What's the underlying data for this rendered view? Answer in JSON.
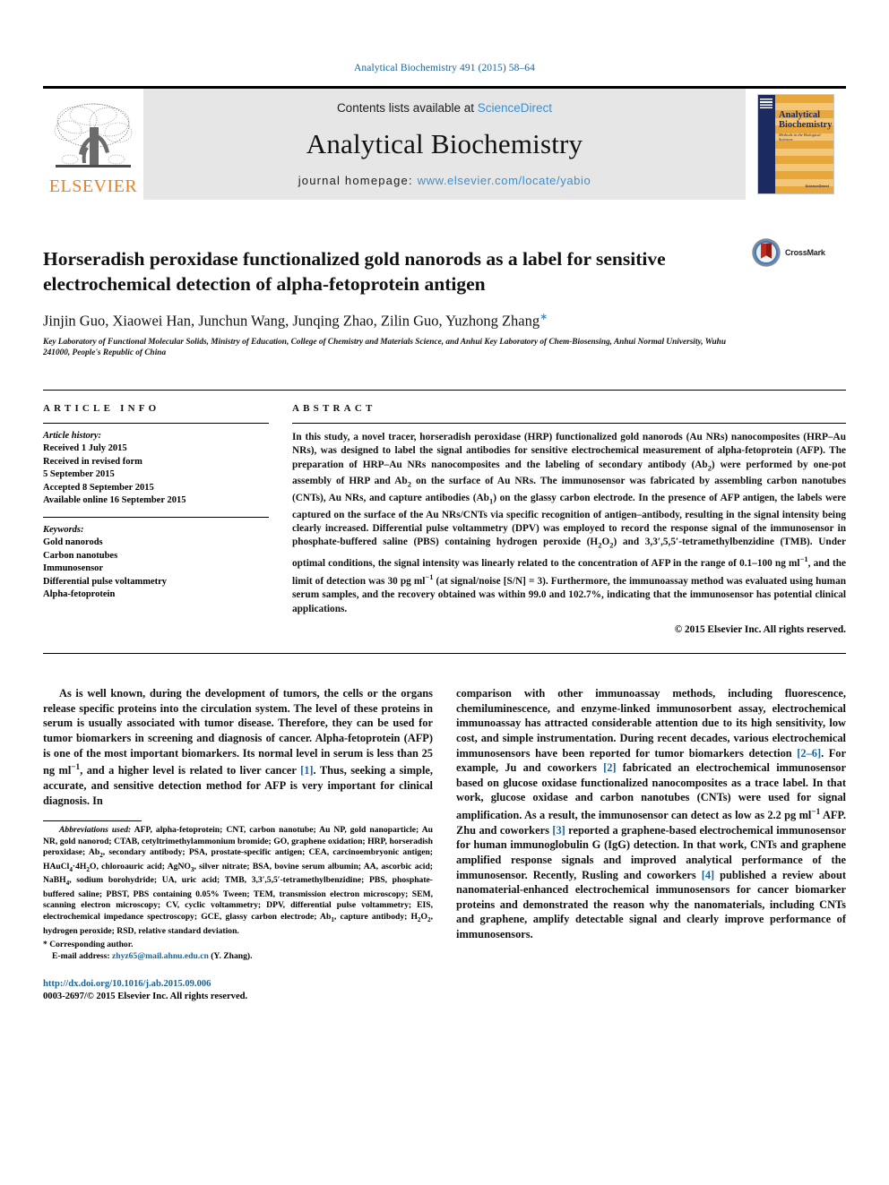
{
  "running_head": "Analytical Biochemistry 491 (2015) 58–64",
  "masthead": {
    "publisher": "ELSEVIER",
    "contents_prefix": "Contents lists available at ",
    "contents_link": "ScienceDirect",
    "journal_title": "Analytical Biochemistry",
    "homepage_label": "journal homepage: ",
    "homepage_url": "www.elsevier.com/locate/yabio",
    "cover": {
      "title_line1": "Analytical",
      "title_line2": "Biochemistry",
      "subtitle": "Methods in the Biological Sciences",
      "footer": "ScienceDirect"
    }
  },
  "article": {
    "title": "Horseradish peroxidase functionalized gold nanorods as a label for sensitive electrochemical detection of alpha-fetoprotein antigen",
    "authors": "Jinjin Guo, Xiaowei Han, Junchun Wang, Junqing Zhao, Zilin Guo, Yuzhong Zhang",
    "corresponding_marker": "∗",
    "affiliation": "Key Laboratory of Functional Molecular Solids, Ministry of Education, College of Chemistry and Materials Science, and Anhui Key Laboratory of Chem-Biosensing, Anhui Normal University, Wuhu 241000, People's Republic of China",
    "crossmark_label": "CrossMark"
  },
  "info": {
    "heading": "ARTICLE INFO",
    "history_label": "Article history:",
    "history": [
      "Received 1 July 2015",
      "Received in revised form",
      "5 September 2015",
      "Accepted 8 September 2015",
      "Available online 16 September 2015"
    ],
    "keywords_label": "Keywords:",
    "keywords": [
      "Gold nanorods",
      "Carbon nanotubes",
      "Immunosensor",
      "Differential pulse voltammetry",
      "Alpha-fetoprotein"
    ]
  },
  "abstract": {
    "heading": "ABSTRACT",
    "text_part1": "In this study, a novel tracer, horseradish peroxidase (HRP) functionalized gold nanorods (Au NRs) nanocomposites (HRP–Au NRs), was designed to label the signal antibodies for sensitive electrochemical measurement of alpha-fetoprotein (AFP). The preparation of HRP–Au NRs nanocomposites and the labeling of secondary antibody (Ab",
    "sub_2a": "2",
    "text_part2": ") were performed by one-pot assembly of HRP and Ab",
    "sub_2b": "2",
    "text_part3": " on the surface of Au NRs. The immunosensor was fabricated by assembling carbon nanotubes (CNTs), Au NRs, and capture antibodies (Ab",
    "sub_1": "1",
    "text_part4": ") on the glassy carbon electrode. In the presence of AFP antigen, the labels were captured on the surface of the Au NRs/CNTs via specific recognition of antigen–antibody, resulting in the signal intensity being clearly increased. Differential pulse voltammetry (DPV) was employed to record the response signal of the immunosensor in phosphate-buffered saline (PBS) containing hydrogen peroxide (H",
    "sub_h2o2_2": "2",
    "text_part5": "O",
    "sub_h2o2_2b": "2",
    "text_part6": ") and 3,3′,5,5′-tetramethylbenzidine (TMB). Under optimal conditions, the signal intensity was linearly related to the concentration of AFP in the range of 0.1–100 ng ml",
    "sup_m1a": "−1",
    "text_part7": ", and the limit of detection was 30 pg ml",
    "sup_m1b": "−1",
    "text_part8": " (at signal/noise [S/N] = 3). Furthermore, the immunoassay method was evaluated using human serum samples, and the recovery obtained was within 99.0 and 102.7%, indicating that the immunosensor has potential clinical applications.",
    "copyright": "© 2015 Elsevier Inc. All rights reserved."
  },
  "body": {
    "left_para_1": "As is well known, during the development of tumors, the cells or the organs release specific proteins into the circulation system. The level of these proteins in serum is usually associated with tumor disease. Therefore, they can be used for tumor biomarkers in screening and diagnosis of cancer. Alpha-fetoprotein (AFP) is one of the most important biomarkers. Its normal level in serum is less than 25 ng ml",
    "left_sup_1": "−1",
    "left_para_1b": ", and a higher level is related to liver cancer ",
    "left_ref_1": "[1]",
    "left_para_1c": ". Thus, seeking a simple, accurate, and sensitive detection method for AFP is very important for clinical diagnosis. In",
    "right_para_1": "comparison with other immunoassay methods, including fluorescence, chemiluminescence, and enzyme-linked immunosorbent assay, electrochemical immunoassay has attracted considerable attention due to its high sensitivity, low cost, and simple instrumentation. During recent decades, various electrochemical immunosensors have been reported for tumor biomarkers detection ",
    "right_ref_1": "[2–6]",
    "right_para_2": ". For example, Ju and coworkers ",
    "right_ref_2": "[2]",
    "right_para_3": " fabricated an electrochemical immunosensor based on glucose oxidase functionalized nanocomposites as a trace label. In that work, glucose oxidase and carbon nanotubes (CNTs) were used for signal amplification. As a result, the immunosensor can detect as low as 2.2 pg ml",
    "right_sup_1": "−1",
    "right_para_4": " AFP. Zhu and coworkers ",
    "right_ref_3": "[3]",
    "right_para_5": " reported a graphene-based electrochemical immunosensor for human immunoglobulin G (IgG) detection. In that work, CNTs and graphene amplified response signals and improved analytical performance of the immunosensor. Recently, Rusling and coworkers ",
    "right_ref_4": "[4]",
    "right_para_6": " published a review about nanomaterial-enhanced electrochemical immunosensors for cancer biomarker proteins and demonstrated the reason why the nanomaterials, including CNTs and graphene, amplify detectable signal and clearly improve performance of immunosensors."
  },
  "footnotes": {
    "abbrev_label": "Abbreviations used:",
    "abbrev_text": " AFP, alpha-fetoprotein; CNT, carbon nanotube; Au NP, gold nanoparticle; Au NR, gold nanorod; CTAB, cetyltrimethylammonium bromide; GO, graphene oxidation; HRP, horseradish peroxidase; Ab",
    "abbrev_sub_2": "2",
    "abbrev_text2": ", secondary antibody; PSA, prostate-specific antigen; CEA, carcinoembryonic antigen; HAuCl",
    "abbrev_sub_4": "4",
    "abbrev_text3": "·4H",
    "abbrev_sub_2b": "2",
    "abbrev_text4": "O, chloroauric acid; AgNO",
    "abbrev_sub_3": "3",
    "abbrev_text5": ", silver nitrate; BSA, bovine serum albumin; AA, ascorbic acid; NaBH",
    "abbrev_sub_4b": "4",
    "abbrev_text6": ", sodium borohydride; UA, uric acid; TMB, 3,3′,5,5′-tetramethylbenzidine; PBS, phosphate-buffered saline; PBST, PBS containing 0.05% Tween; TEM, transmission electron microscopy; SEM, scanning electron microscopy; CV, cyclic voltammetry; DPV, differential pulse voltammetry; EIS, electrochemical impedance spectroscopy; GCE, glassy carbon electrode; Ab",
    "abbrev_sub_1": "1",
    "abbrev_text7": ", capture antibody; H",
    "abbrev_sub_h2": "2",
    "abbrev_text8": "O",
    "abbrev_sub_o2": "2",
    "abbrev_text9": ", hydrogen peroxide; RSD, relative standard deviation.",
    "corresponding": "Corresponding author.",
    "email_label": "E-mail address:",
    "email": "zhyz65@mail.ahnu.edu.cn",
    "email_suffix": " (Y. Zhang).",
    "doi": "http://dx.doi.org/10.1016/j.ab.2015.09.006",
    "issn": "0003-2697/© 2015 Elsevier Inc. All rights reserved."
  }
}
